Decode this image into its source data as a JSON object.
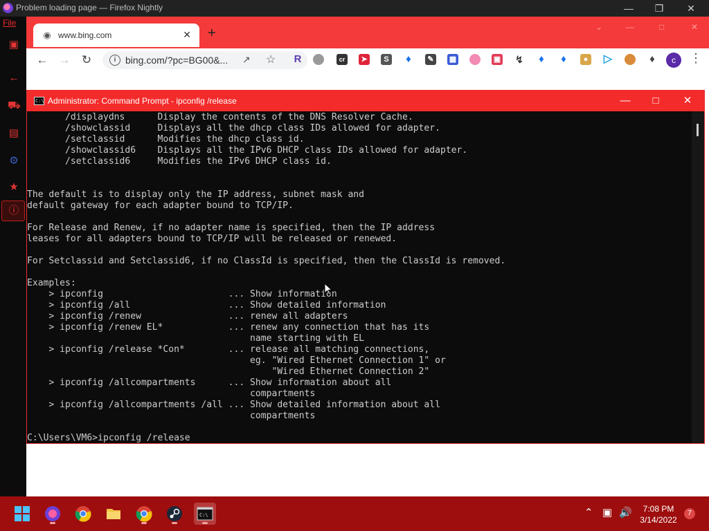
{
  "firefox": {
    "window_title": "Problem loading page — Firefox Nightly",
    "menu_file": "File",
    "tab_title": "www.bing.com",
    "url": "bing.com/?pc=BG00&...",
    "profile_initial": "c"
  },
  "cmd": {
    "title": "Administrator: Command Prompt - ipconfig  /release",
    "lines": [
      "       /displaydns      Display the contents of the DNS Resolver Cache.",
      "       /showclassid     Displays all the dhcp class IDs allowed for adapter.",
      "       /setclassid      Modifies the dhcp class id.",
      "       /showclassid6    Displays all the IPv6 DHCP class IDs allowed for adapter.",
      "       /setclassid6     Modifies the IPv6 DHCP class id.",
      "",
      "",
      "The default is to display only the IP address, subnet mask and",
      "default gateway for each adapter bound to TCP/IP.",
      "",
      "For Release and Renew, if no adapter name is specified, then the IP address",
      "leases for all adapters bound to TCP/IP will be released or renewed.",
      "",
      "For Setclassid and Setclassid6, if no ClassId is specified, then the ClassId is removed.",
      "",
      "Examples:",
      "    > ipconfig                       ... Show information",
      "    > ipconfig /all                  ... Show detailed information",
      "    > ipconfig /renew                ... renew all adapters",
      "    > ipconfig /renew EL*            ... renew any connection that has its",
      "                                         name starting with EL",
      "    > ipconfig /release *Con*        ... release all matching connections,",
      "                                         eg. \"Wired Ethernet Connection 1\" or",
      "                                             \"Wired Ethernet Connection 2\"",
      "    > ipconfig /allcompartments      ... Show information about all",
      "                                         compartments",
      "    > ipconfig /allcompartments /all ... Show detailed information about all",
      "                                         compartments",
      "",
      "C:\\Users\\VM6>ipconfig /release"
    ]
  },
  "taskbar": {
    "time": "7:08 PM",
    "date": "3/14/2022",
    "notification_count": "7"
  },
  "colors": {
    "accent_red": "#f42b2b",
    "taskbar_red": "#9e0e0e",
    "console_bg": "#0c0c0c",
    "console_fg": "#cccccc"
  }
}
